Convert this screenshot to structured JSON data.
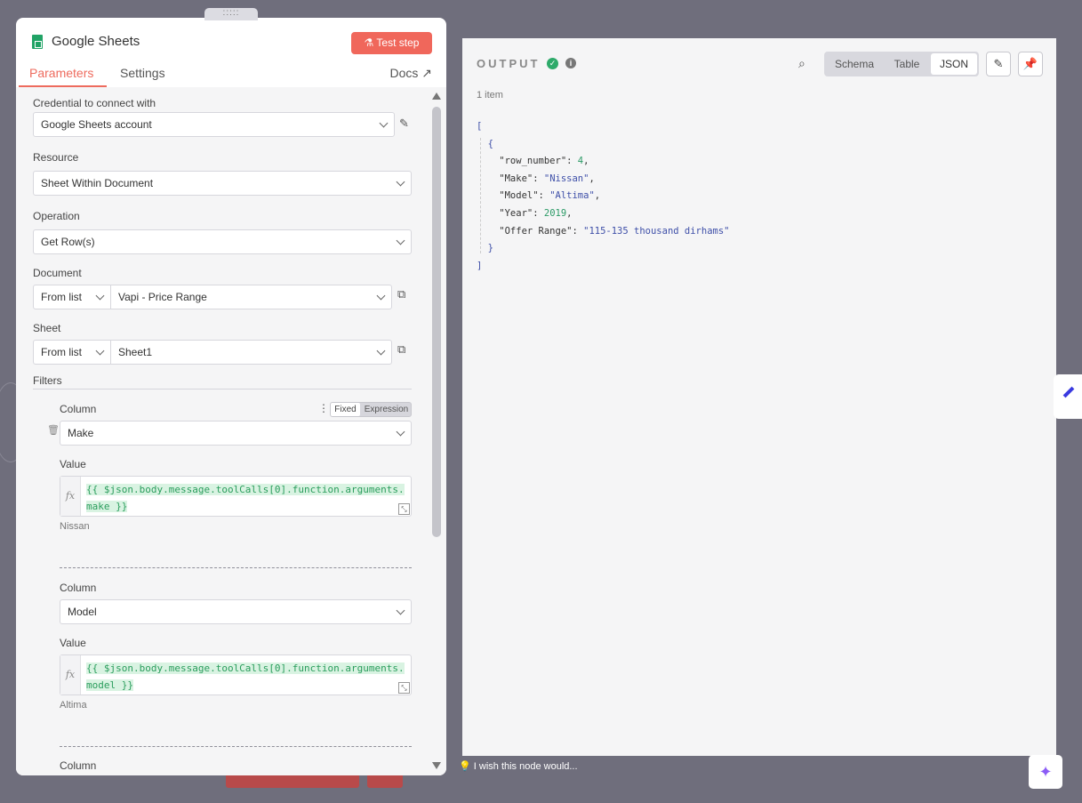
{
  "panel": {
    "title": "Google Sheets",
    "test_step": "Test step",
    "tabs": [
      "Parameters",
      "Settings"
    ],
    "docs": "Docs",
    "credential_label": "Credential to connect with",
    "credential_value": "Google Sheets account",
    "resource_label": "Resource",
    "resource_value": "Sheet Within Document",
    "operation_label": "Operation",
    "operation_value": "Get Row(s)",
    "document_label": "Document",
    "document_mode": "From list",
    "document_value": "Vapi - Price Range",
    "sheet_label": "Sheet",
    "sheet_mode": "From list",
    "sheet_value": "Sheet1",
    "filters_label": "Filters",
    "fixed": "Fixed",
    "expression": "Expression",
    "filters": [
      {
        "column_label": "Column",
        "column_value": "Make",
        "value_label": "Value",
        "expr_line1": "{{ $json.body.message.toolCalls[0].function.arguments.",
        "expr_line2": "make }}",
        "preview": "Nissan"
      },
      {
        "column_label": "Column",
        "column_value": "Model",
        "value_label": "Value",
        "expr_line1": "{{ $json.body.message.toolCalls[0].function.arguments.",
        "expr_line2": "model }}",
        "preview": "Altima"
      }
    ],
    "third_column_label": "Column"
  },
  "output": {
    "title": "OUTPUT",
    "views": [
      "Schema",
      "Table",
      "JSON"
    ],
    "selected_view": "JSON",
    "item_count": "1 item",
    "json_lines": [
      "[",
      "  {",
      "    \"row_number\":",
      "    \"Make\":",
      "    \"Model\":",
      "    \"Year\":",
      "    \"Offer Range\":",
      "  }",
      "]"
    ],
    "values": {
      "row_number": "4",
      "Make": "\"Nissan\"",
      "Model": "\"Altima\"",
      "Year": "2019",
      "Offer Range": "\"115-135 thousand dirhams\""
    }
  },
  "footer": {
    "wish": "I wish this node would..."
  },
  "colors": {
    "accent": "#ee6b5e",
    "success": "#2eaa6a",
    "background": "#6f6e7c"
  }
}
